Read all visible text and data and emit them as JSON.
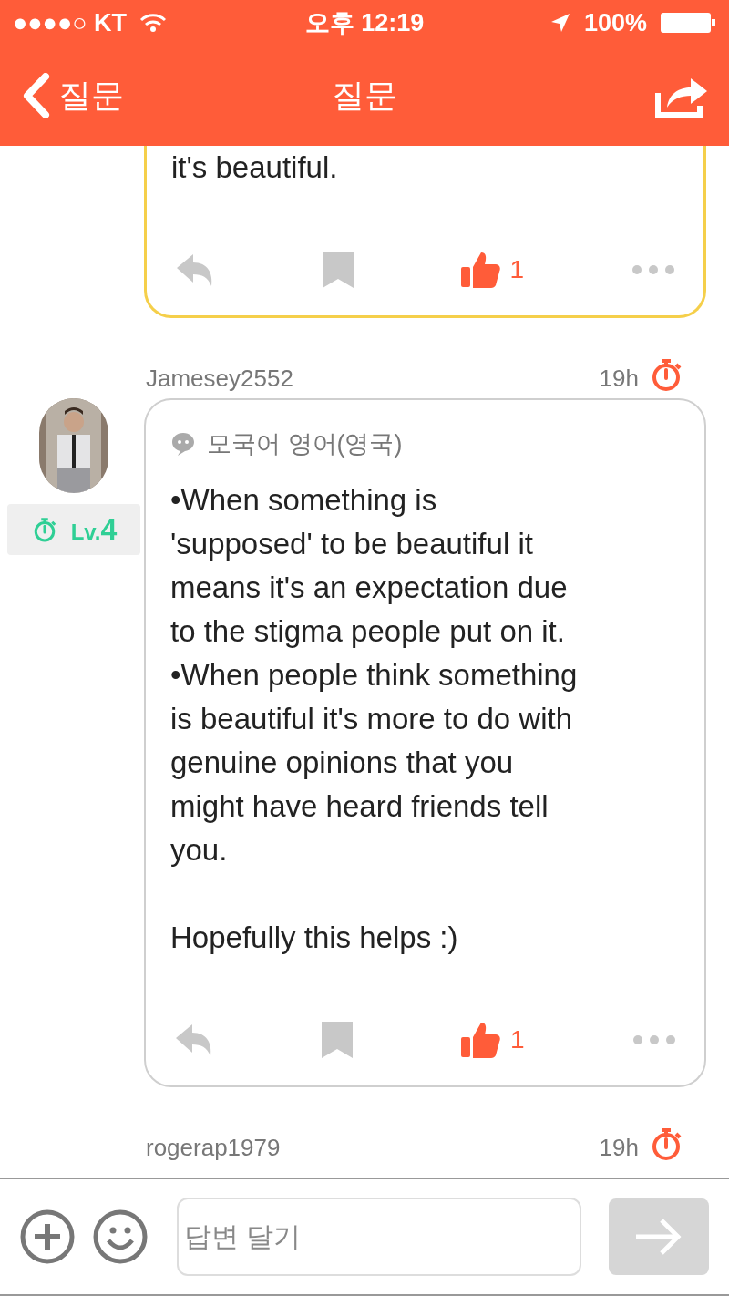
{
  "status_bar": {
    "carrier": "●●●●○ KT",
    "time": "오후 12:19",
    "battery": "100%"
  },
  "nav_bar": {
    "back_label": "질문",
    "title": "질문"
  },
  "answers": [
    {
      "highlighted": true,
      "body": "it's beautiful.",
      "liked": true,
      "like_count": "1"
    },
    {
      "highlighted": false,
      "username": "Jamesey2552",
      "time": "19h",
      "rank_prefix": "Lv.",
      "rank": "4",
      "language": "모국어 영어(영국)",
      "body": "•When something is\n'supposed' to be beautiful it\nmeans it's an expectation due\nto the stigma people put on it.\n•When people think something\nis beautiful it's more to do with\ngenuine opinions that you\nmight have heard friends tell\nyou.\n\nHopefully this helps :)",
      "liked": true,
      "like_count": "1"
    },
    {
      "username": "rogerap1979",
      "time": "19h"
    }
  ],
  "reply_bar": {
    "placeholder": "답변 달기"
  }
}
